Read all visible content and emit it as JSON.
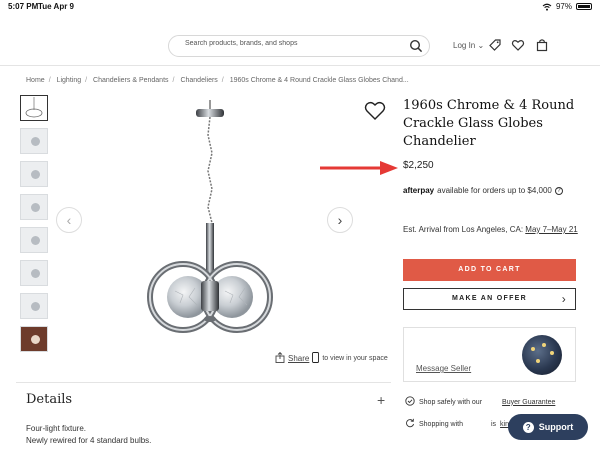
{
  "status_bar": {
    "time": "5:07 PM",
    "date": "Tue Apr 9",
    "battery": "97%",
    "battery_level": 0.97
  },
  "header": {
    "search_placeholder": "Search products, brands, and shops",
    "login_label": "Log In",
    "icons": [
      "search-icon",
      "chevron-down-icon",
      "tag-icon",
      "heart-icon",
      "bag-icon"
    ]
  },
  "breadcrumb": [
    "Home",
    "Lighting",
    "Chandeliers & Pendants",
    "Chandeliers",
    "1960s Chrome & 4 Round Crackle Glass Globes Chand..."
  ],
  "product": {
    "title": "1960s Chrome & 4 Round Crackle Glass Globes Chandelier",
    "price": "$2,250",
    "afterpay_logo": "afterpay",
    "afterpay_text": "available for orders up to $4,000",
    "arrival_prefix": "Est. Arrival from Los Angeles, CA:",
    "arrival_dates": "May 7–May 21",
    "add_to_cart": "ADD TO CART",
    "make_offer": "MAKE AN OFFER",
    "share_label": "Share",
    "view_in_space": "to view in your space"
  },
  "seller": {
    "message_label": "Message Seller"
  },
  "details": {
    "title": "Details",
    "lines": [
      "Four-light fixture.",
      "Newly rewired for 4 standard bulbs."
    ]
  },
  "trust": {
    "shop_safely": "Shop safely with our",
    "buyer_guarantee": "Buyer Guarantee",
    "shopping_with": "Shopping with",
    "is_text": "is",
    "kind": "kind"
  },
  "support": {
    "label": "Support"
  },
  "colors": {
    "cart_button": "#e05a46",
    "support_button": "#2d3f5e",
    "annotation_arrow": "#e53935"
  }
}
